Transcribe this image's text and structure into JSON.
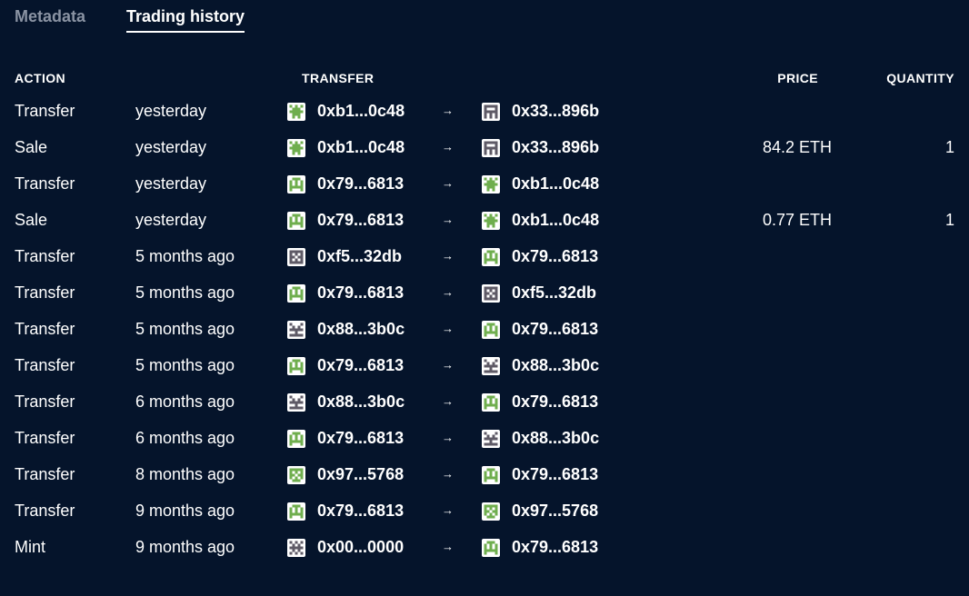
{
  "tabs": [
    {
      "label": "Metadata",
      "active": false
    },
    {
      "label": "Trading history",
      "active": true
    }
  ],
  "headers": {
    "action": "ACTION",
    "transfer": "TRANSFER",
    "price": "PRICE",
    "quantity": "QUANTITY"
  },
  "arrow_glyph": "→",
  "rows": [
    {
      "action": "Transfer",
      "time": "yesterday",
      "from": "0xb1...0c48",
      "from_icon": "avatar-b1-icon",
      "to": "0x33...896b",
      "to_icon": "avatar-33-icon",
      "price": "",
      "qty": ""
    },
    {
      "action": "Sale",
      "time": "yesterday",
      "from": "0xb1...0c48",
      "from_icon": "avatar-b1-icon",
      "to": "0x33...896b",
      "to_icon": "avatar-33-icon",
      "price": "84.2 ETH",
      "qty": "1"
    },
    {
      "action": "Transfer",
      "time": "yesterday",
      "from": "0x79...6813",
      "from_icon": "avatar-79-icon",
      "to": "0xb1...0c48",
      "to_icon": "avatar-b1-icon",
      "price": "",
      "qty": ""
    },
    {
      "action": "Sale",
      "time": "yesterday",
      "from": "0x79...6813",
      "from_icon": "avatar-79-icon",
      "to": "0xb1...0c48",
      "to_icon": "avatar-b1-icon",
      "price": "0.77 ETH",
      "qty": "1"
    },
    {
      "action": "Transfer",
      "time": "5 months ago",
      "from": "0xf5...32db",
      "from_icon": "avatar-f5-icon",
      "to": "0x79...6813",
      "to_icon": "avatar-79-icon",
      "price": "",
      "qty": ""
    },
    {
      "action": "Transfer",
      "time": "5 months ago",
      "from": "0x79...6813",
      "from_icon": "avatar-79-icon",
      "to": "0xf5...32db",
      "to_icon": "avatar-f5-icon",
      "price": "",
      "qty": ""
    },
    {
      "action": "Transfer",
      "time": "5 months ago",
      "from": "0x88...3b0c",
      "from_icon": "avatar-88-icon",
      "to": "0x79...6813",
      "to_icon": "avatar-79-icon",
      "price": "",
      "qty": ""
    },
    {
      "action": "Transfer",
      "time": "5 months ago",
      "from": "0x79...6813",
      "from_icon": "avatar-79-icon",
      "to": "0x88...3b0c",
      "to_icon": "avatar-88-icon",
      "price": "",
      "qty": ""
    },
    {
      "action": "Transfer",
      "time": "6 months ago",
      "from": "0x88...3b0c",
      "from_icon": "avatar-88-icon",
      "to": "0x79...6813",
      "to_icon": "avatar-79-icon",
      "price": "",
      "qty": ""
    },
    {
      "action": "Transfer",
      "time": "6 months ago",
      "from": "0x79...6813",
      "from_icon": "avatar-79-icon",
      "to": "0x88...3b0c",
      "to_icon": "avatar-88-icon",
      "price": "",
      "qty": ""
    },
    {
      "action": "Transfer",
      "time": "8 months ago",
      "from": "0x97...5768",
      "from_icon": "avatar-97-icon",
      "to": "0x79...6813",
      "to_icon": "avatar-79-icon",
      "price": "",
      "qty": ""
    },
    {
      "action": "Transfer",
      "time": "9 months ago",
      "from": "0x79...6813",
      "from_icon": "avatar-79-icon",
      "to": "0x97...5768",
      "to_icon": "avatar-97-icon",
      "price": "",
      "qty": ""
    },
    {
      "action": "Mint",
      "time": "9 months ago",
      "from": "0x00...0000",
      "from_icon": "avatar-00-icon",
      "to": "0x79...6813",
      "to_icon": "avatar-79-icon",
      "price": "",
      "qty": ""
    }
  ],
  "colors": {
    "background": "#05142b",
    "text": "#ffffff",
    "inactive_tab": "#8a93a3",
    "avatar_green": "#6fae4e",
    "avatar_gray": "#5e5a66"
  }
}
